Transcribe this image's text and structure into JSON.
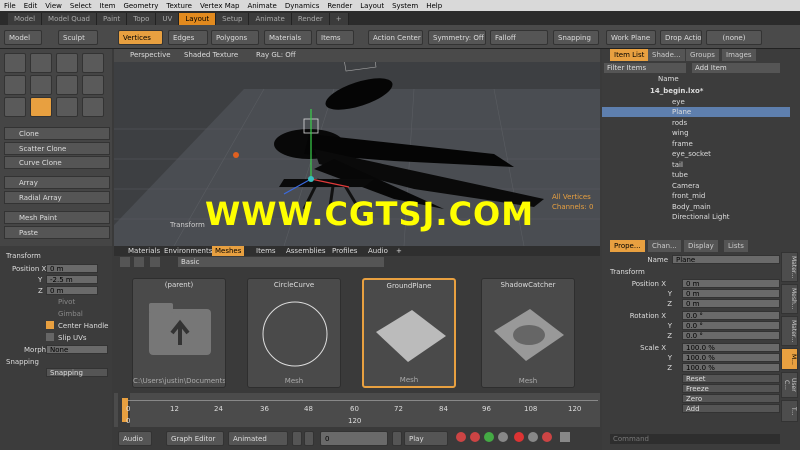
{
  "menu": [
    "File",
    "Edit",
    "View",
    "Select",
    "Item",
    "Geometry",
    "Texture",
    "Vertex Map",
    "Animate",
    "Dynamics",
    "Render",
    "Layout",
    "System",
    "Help"
  ],
  "tabs": [
    "Model",
    "Model Quad",
    "Paint",
    "Topo",
    "UV",
    "Layout",
    "Setup",
    "Animate",
    "Render",
    "+"
  ],
  "toolbar": {
    "model": "Model",
    "sculpt": "Sculpt",
    "vertices": "Vertices",
    "edges": "Edges",
    "polygons": "Polygons",
    "materials": "Materials",
    "items": "Items",
    "action_center": "Action Center",
    "symmetry": "Symmetry: Off",
    "falloff": "Falloff",
    "snapping": "Snapping",
    "work_plane": "Work Plane",
    "drop_action": "Drop Action",
    "none": "(none)"
  },
  "left_buttons": [
    "Clone",
    "Scatter Clone",
    "Curve Clone",
    "Array",
    "Radial Array",
    "Mesh Paint",
    "Paste"
  ],
  "viewport": {
    "perspective": "Perspective",
    "shaded": "Shaded Texture",
    "raygl": "Ray GL: Off",
    "all_vertices": "All Vertices",
    "channels": "Channels: 0",
    "transform": "Transform"
  },
  "watermark": "WWW.CGTSJ.COM",
  "items_tabs": [
    "Item List",
    "Shade...",
    "Groups",
    "Images"
  ],
  "filter": "Filter Items",
  "add_item": "Add Item",
  "name_col": "Name",
  "items": [
    "14_begin.lxo*",
    "eye",
    "Plane",
    "rods",
    "wing",
    "frame",
    "eye_socket",
    "tail",
    "tube",
    "Camera",
    "front_mid",
    "Body_main",
    "Directional Light"
  ],
  "left_props": {
    "transform": "Transform",
    "position": "Position X",
    "x": "0 m",
    "y": "-2.5 m",
    "z": "0 m",
    "pivot": "Pivot",
    "gimbal": "Gimbal",
    "center_handle": "Center Handle",
    "slip_uvs": "Slip UVs",
    "morph": "Morph",
    "morph_val": "None",
    "snapping": "Snapping",
    "snapping_btn": "Snapping"
  },
  "mid_tabs": [
    "Materials",
    "Environments",
    "Meshes",
    "Items",
    "Assemblies",
    "Profiles",
    "Audio",
    "+"
  ],
  "basic": "Basic",
  "cards": [
    {
      "title": "(parent)",
      "sub": "C:\\Users\\justin\\Documents\\..."
    },
    {
      "title": "CircleCurve",
      "sub": "Mesh"
    },
    {
      "title": "GroundPlane",
      "sub": "Mesh"
    },
    {
      "title": "ShadowCatcher",
      "sub": "Mesh"
    }
  ],
  "ticks_top": [
    "0",
    "12",
    "24",
    "36",
    "48",
    "60",
    "72",
    "84",
    "96",
    "108",
    "120"
  ],
  "ticks_bot": [
    "0",
    "",
    "",
    "",
    "",
    "",
    "",
    "",
    "",
    "",
    "120"
  ],
  "bottom": {
    "audio": "Audio",
    "graph": "Graph Editor",
    "animated": "Animated",
    "frame": "0",
    "play": "Play"
  },
  "prop_tabs": [
    "Prope...",
    "Chan...",
    "Display",
    "Lists"
  ],
  "props": {
    "name_label": "Name",
    "name": "Plane",
    "transform": "Transform",
    "position": "Position X",
    "px": "0 m",
    "py": "0 m",
    "pz": "0 m",
    "rotation": "Rotation X",
    "rx": "0.0 °",
    "ry": "0.0 °",
    "rz": "0.0 °",
    "scale": "Scale X",
    "sx": "100.0 %",
    "sy": "100.0 %",
    "sz": "100.0 %",
    "reset": "Reset",
    "freeze": "Freeze",
    "zero": "Zero",
    "add": "Add",
    "command": "Command"
  },
  "vtabs": [
    "Mater...",
    "Mesh...",
    "Mater...",
    "M...",
    "User C...",
    "T..."
  ],
  "y": "Y",
  "z": "Z"
}
